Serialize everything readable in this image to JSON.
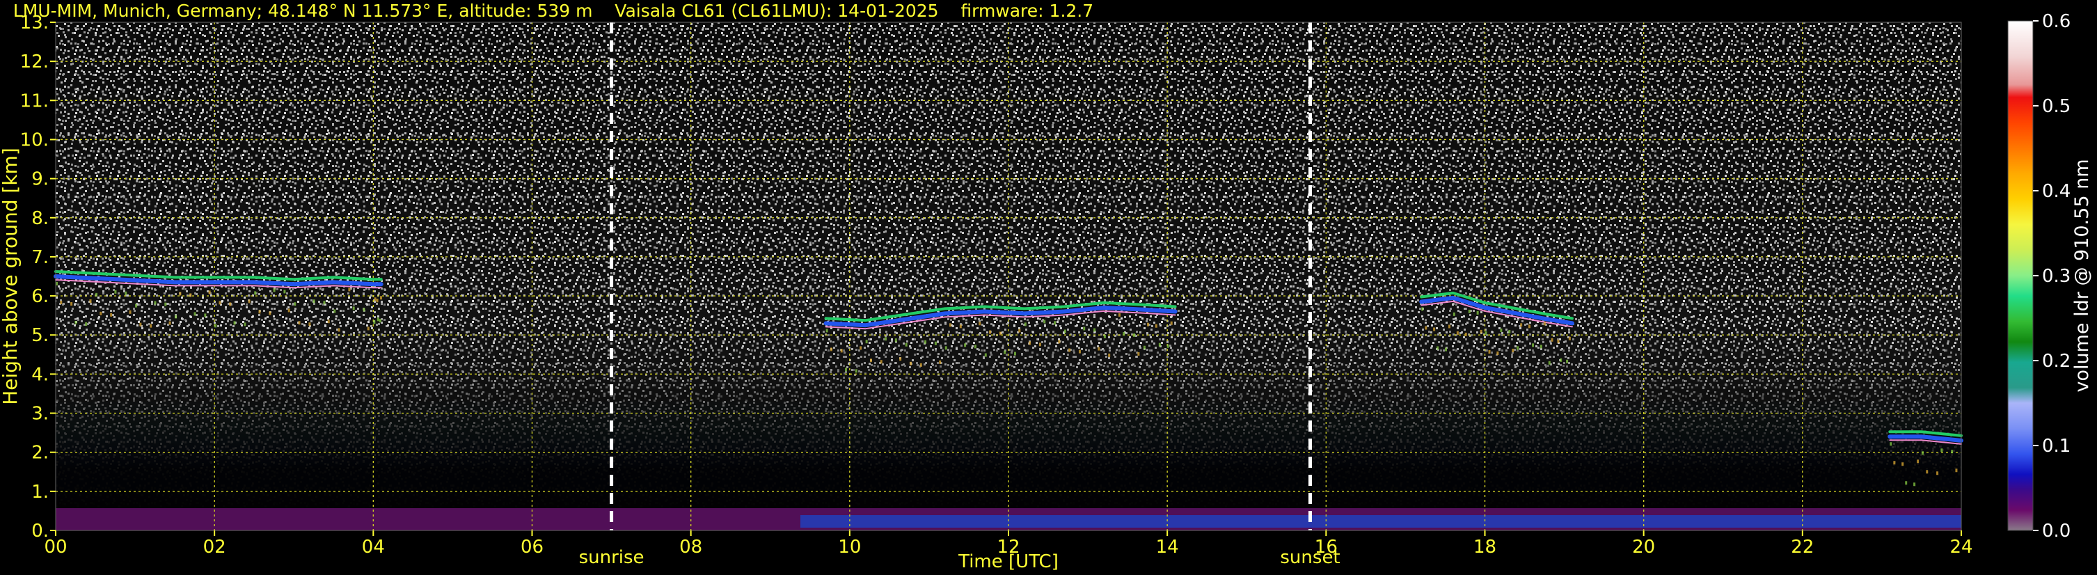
{
  "page": {
    "title": "LMU-MIM, Munich, Germany; 48.148° N 11.573° E, altitude: 539 m    Vaisala CL61 (CL61LMU): 14-01-2025    firmware: 1.2.7"
  },
  "colors": {
    "text": "#ffff33",
    "grid": "#cccc22",
    "background": "#000000",
    "marker": "#ffffff"
  },
  "chart_data": {
    "type": "heatmap",
    "title": "LMU-MIM, Munich, Germany; 48.148° N 11.573° E, altitude: 539 m    Vaisala CL61 (CL61LMU): 14-01-2025    firmware: 1.2.7",
    "xlabel": "Time [UTC]",
    "ylabel": "Height above ground [km]",
    "xlim": [
      0,
      24
    ],
    "ylim": [
      0,
      13
    ],
    "x_ticks": [
      "00",
      "02",
      "04",
      "06",
      "08",
      "10",
      "12",
      "14",
      "16",
      "18",
      "20",
      "22",
      "24"
    ],
    "y_ticks": [
      "0.",
      "1.",
      "2.",
      "3.",
      "4.",
      "5.",
      "6.",
      "7.",
      "8.",
      "9.",
      "10.",
      "11.",
      "12.",
      "13."
    ],
    "grid": true,
    "markers": [
      {
        "label": "sunrise",
        "x": 7.0
      },
      {
        "label": "sunset",
        "x": 15.8
      }
    ],
    "colorbar": {
      "label": "volume ldr @ 910.55 nm",
      "range": [
        0.0,
        0.6
      ],
      "ticks": [
        "0.0",
        "0.1",
        "0.2",
        "0.3",
        "0.4",
        "0.5",
        "0.6"
      ]
    },
    "cloud_layers": [
      {
        "x": [
          0.0,
          0.5,
          1.0,
          1.5,
          2.0,
          2.5,
          3.0,
          3.5,
          4.0,
          4.1
        ],
        "y": [
          6.5,
          6.45,
          6.4,
          6.35,
          6.35,
          6.35,
          6.3,
          6.35,
          6.3,
          6.3
        ]
      },
      {
        "x": [
          9.7,
          10.2,
          10.7,
          11.2,
          11.7,
          12.2,
          12.7,
          13.2,
          13.7,
          14.1
        ],
        "y": [
          5.3,
          5.25,
          5.4,
          5.55,
          5.6,
          5.55,
          5.6,
          5.7,
          5.65,
          5.6
        ]
      },
      {
        "x": [
          17.2,
          17.6,
          18.0,
          18.4,
          18.8,
          19.1
        ],
        "y": [
          5.85,
          5.95,
          5.7,
          5.55,
          5.4,
          5.3
        ]
      },
      {
        "x": [
          23.1,
          23.5,
          24.0
        ],
        "y": [
          2.4,
          2.4,
          2.3
        ]
      }
    ]
  }
}
